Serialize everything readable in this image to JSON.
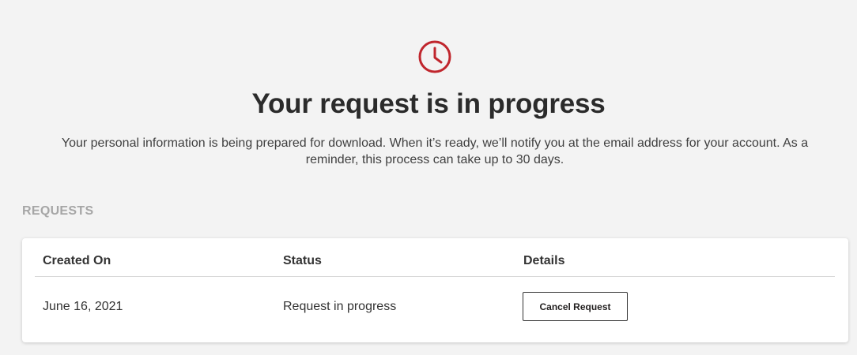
{
  "icon": {
    "name": "clock-icon",
    "color": "#c0262d"
  },
  "headline": "Your request is in progress",
  "description": "Your personal information is being prepared for download. When it’s ready, we’ll notify you at the email address for your account. As a reminder, this process can take up to 30 days.",
  "requests": {
    "section_label": "REQUESTS",
    "columns": [
      "Created On",
      "Status",
      "Details"
    ],
    "rows": [
      {
        "created_on": "June 16, 2021",
        "status": "Request in progress",
        "action_label": "Cancel Request"
      }
    ]
  }
}
